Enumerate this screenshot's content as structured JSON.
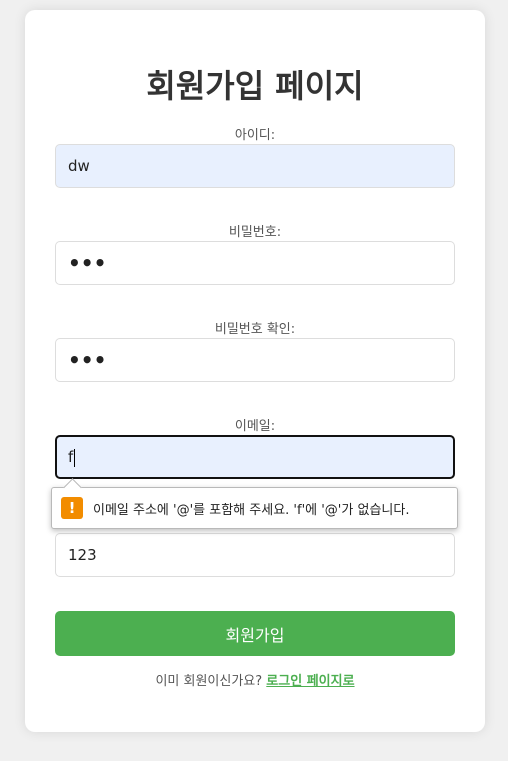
{
  "page": {
    "title": "회원가입 페이지"
  },
  "form": {
    "id_label": "아이디:",
    "id_value": "dw",
    "password_label": "비밀번호:",
    "password_value": "•••",
    "password_confirm_label": "비밀번호 확인:",
    "password_confirm_value": "•••",
    "email_label": "이메일:",
    "email_value": "f",
    "phone_value": "123",
    "submit_label": "회원가입"
  },
  "validation_tooltip": {
    "icon": "warning-icon",
    "icon_glyph": "!",
    "message": "이메일 주소에 '@'를 포함해 주세요. 'f'에 '@'가 없습니다."
  },
  "footer": {
    "prompt": "이미 회원이신가요?",
    "login_link": "로그인 페이지로"
  },
  "colors": {
    "accent": "#4caf50",
    "warning": "#f28c00",
    "autofill": "#e8f0fe"
  }
}
